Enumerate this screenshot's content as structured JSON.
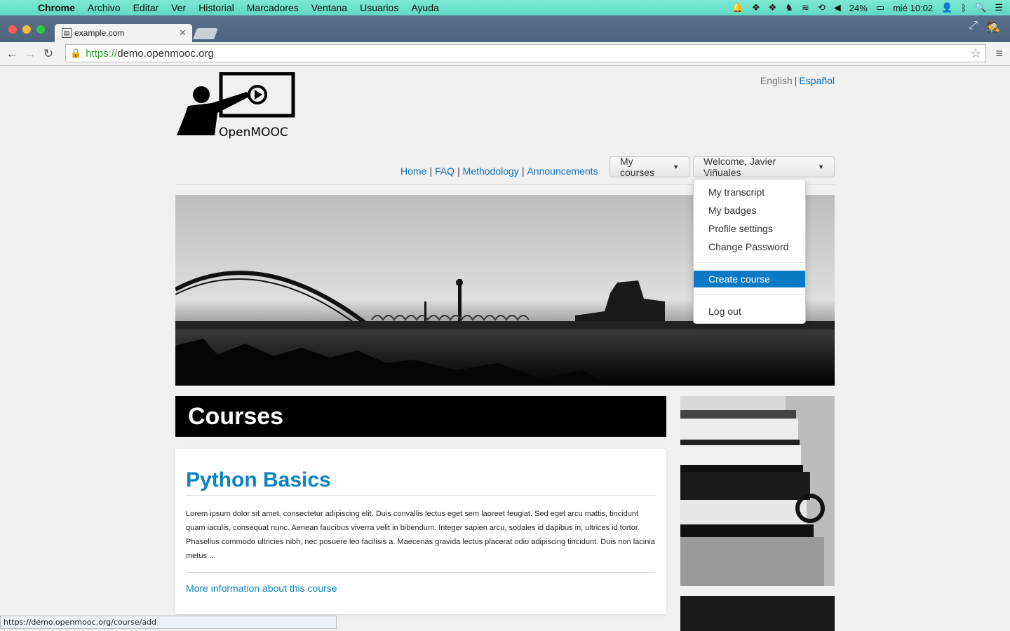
{
  "os_menubar": {
    "app": "Chrome",
    "menus": [
      "Archivo",
      "Editar",
      "Ver",
      "Historial",
      "Marcadores",
      "Ventana",
      "Usuarios",
      "Ayuda"
    ],
    "battery": "24%",
    "clock": "mié 10:02"
  },
  "browser": {
    "tab_title": "example.com",
    "url_scheme": "https://",
    "url_rest": "demo.openmooc.org",
    "status_url": "https://demo.openmooc.org/course/add"
  },
  "site": {
    "logo_text": "OpenMOOC",
    "lang": {
      "english": "English",
      "sep": "|",
      "espanol": "Español"
    },
    "nav": [
      "Home",
      "FAQ",
      "Methodology",
      "Announcements"
    ],
    "nav_sep": "|",
    "my_courses": "My courses",
    "welcome": "Welcome, Javier Viñuales",
    "dropdown": {
      "transcript": "My transcript",
      "badges": "My badges",
      "profile": "Profile settings",
      "password": "Change Password",
      "create": "Create course",
      "logout": "Log out"
    },
    "courses_heading": "Courses",
    "course": {
      "title": "Python Basics",
      "description": "Lorem ipsum dolor sit amet, consectetur adipiscing elit. Duis convallis lectus eget sem laoreet feugiat. Sed eget arcu mattis, tincidunt quam iaculis, consequat nunc. Aenean faucibus viverra velit in bibendum. Integer sapien arcu, sodales id dapibus in, ultrices id tortor. Phasellus commodo ultricies nibh, nec posuere leo facilisis a. Maecenas gravida lectus placerat odio adipiscing tincidunt. Duis non lacinia metus ...",
      "more": "More information about this course"
    }
  },
  "colors": {
    "link": "#0a6fbf",
    "menubar": "#6ee0cb",
    "active": "#0a7ac4"
  }
}
